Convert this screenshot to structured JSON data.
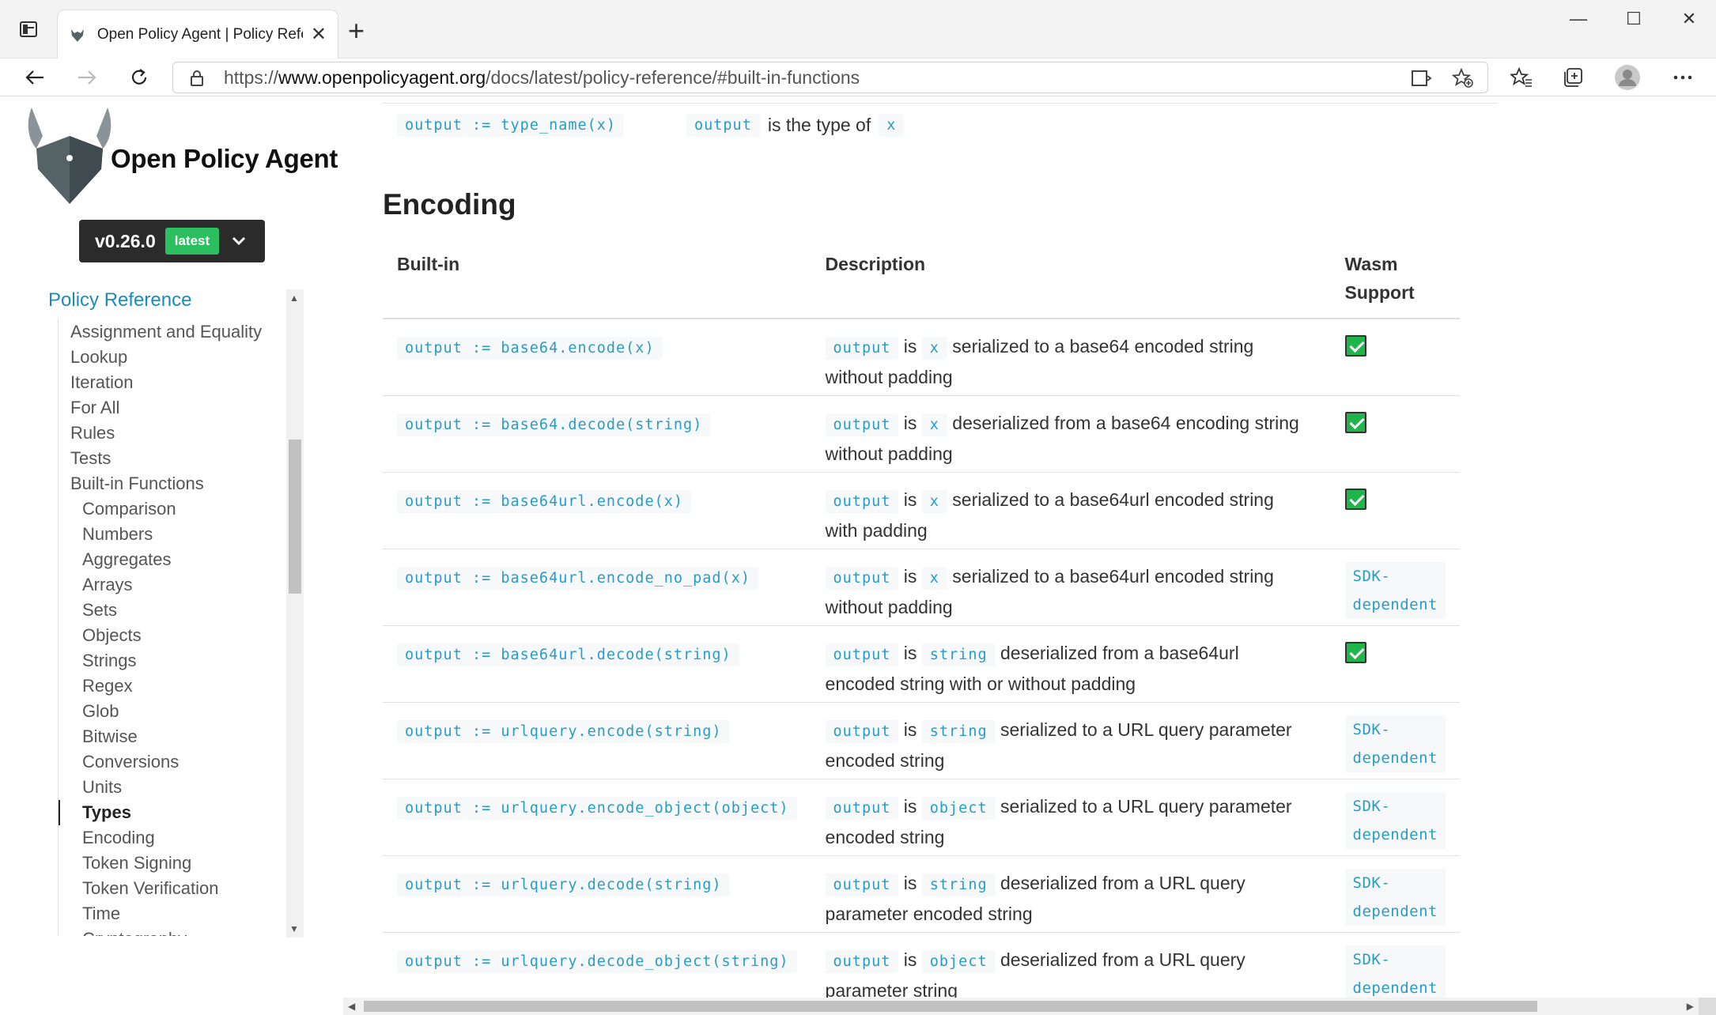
{
  "browser": {
    "tab_title": "Open Policy Agent | Policy Reference",
    "url_scheme": "https://",
    "url_host": "www.openpolicyagent.org",
    "url_path": "/docs/latest/policy-reference/#built-in-functions",
    "new_tab_label": "+"
  },
  "sidebar": {
    "brand": "Open Policy Agent",
    "version": "v0.26.0",
    "version_badge": "latest",
    "nav_heading": "Policy Reference",
    "items": [
      {
        "label": "Assignment and Equality",
        "level": 1
      },
      {
        "label": "Lookup",
        "level": 1
      },
      {
        "label": "Iteration",
        "level": 1
      },
      {
        "label": "For All",
        "level": 1
      },
      {
        "label": "Rules",
        "level": 1
      },
      {
        "label": "Tests",
        "level": 1
      },
      {
        "label": "Built-in Functions",
        "level": 1
      },
      {
        "label": "Comparison",
        "level": 2
      },
      {
        "label": "Numbers",
        "level": 2
      },
      {
        "label": "Aggregates",
        "level": 2
      },
      {
        "label": "Arrays",
        "level": 2
      },
      {
        "label": "Sets",
        "level": 2
      },
      {
        "label": "Objects",
        "level": 2
      },
      {
        "label": "Strings",
        "level": 2
      },
      {
        "label": "Regex",
        "level": 2
      },
      {
        "label": "Glob",
        "level": 2
      },
      {
        "label": "Bitwise",
        "level": 2
      },
      {
        "label": "Conversions",
        "level": 2
      },
      {
        "label": "Units",
        "level": 2
      },
      {
        "label": "Types",
        "level": 2,
        "active": true
      },
      {
        "label": "Encoding",
        "level": 2
      },
      {
        "label": "Token Signing",
        "level": 2
      },
      {
        "label": "Token Verification",
        "level": 2
      },
      {
        "label": "Time",
        "level": 2
      },
      {
        "label": "Cryptography",
        "level": 2
      }
    ]
  },
  "content": {
    "type_row": {
      "code": "output := type_name(x)",
      "desc_code1": "output",
      "desc_text": "is the type of",
      "desc_code2": "x"
    },
    "section_title": "Encoding",
    "table": {
      "headers": [
        "Built-in",
        "Description",
        "Wasm Support"
      ],
      "rows": [
        {
          "builtin": "output := base64.encode(x)",
          "subject": "output",
          "is": "is",
          "arg": "x",
          "text": "serialized to a base64 encoded string without padding",
          "wasm": "check"
        },
        {
          "builtin": "output := base64.decode(string)",
          "subject": "output",
          "is": "is",
          "arg": "x",
          "text": "deserialized from a base64 encoding string without padding",
          "wasm": "check"
        },
        {
          "builtin": "output := base64url.encode(x)",
          "subject": "output",
          "is": "is",
          "arg": "x",
          "text": "serialized to a base64url encoded string with padding",
          "wasm": "check"
        },
        {
          "builtin": "output := base64url.encode_no_pad(x)",
          "subject": "output",
          "is": "is",
          "arg": "x",
          "text": "serialized to a base64url encoded string without padding",
          "wasm": "SDK-dependent"
        },
        {
          "builtin": "output := base64url.decode(string)",
          "subject": "output",
          "is": "is",
          "arg": "string",
          "text": "deserialized from a base64url encoded string with or without padding",
          "wasm": "check"
        },
        {
          "builtin": "output := urlquery.encode(string)",
          "subject": "output",
          "is": "is",
          "arg": "string",
          "text": "serialized to a URL query parameter encoded string",
          "wasm": "SDK-dependent"
        },
        {
          "builtin": "output := urlquery.encode_object(object)",
          "subject": "output",
          "is": "is",
          "arg": "object",
          "text": "serialized to a URL query parameter encoded string",
          "wasm": "SDK-dependent"
        },
        {
          "builtin": "output := urlquery.decode(string)",
          "subject": "output",
          "is": "is",
          "arg": "string",
          "text": "deserialized from a URL query parameter encoded string",
          "wasm": "SDK-dependent"
        },
        {
          "builtin": "output := urlquery.decode_object(string)",
          "subject": "output",
          "is": "is",
          "arg": "object",
          "text": "deserialized from a URL query parameter string",
          "wasm": "SDK-dependent"
        }
      ]
    }
  },
  "colors": {
    "link": "#1b8bb8",
    "code": "#2a9cc4",
    "badge": "#2bbf5f",
    "check": "#1fb54a"
  }
}
